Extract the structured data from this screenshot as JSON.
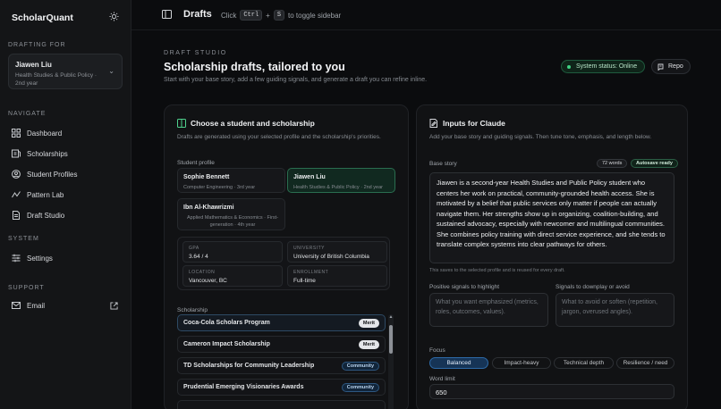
{
  "app": {
    "brand": "ScholarQuant"
  },
  "sidebar": {
    "drafting_for_label": "DRAFTING FOR",
    "profile": {
      "name": "Jiawen Liu",
      "subtitle": "Health Studies & Public Policy · 2nd year"
    },
    "navigate_label": "NAVIGATE",
    "nav": [
      {
        "label": "Dashboard",
        "icon": "dashboard-icon"
      },
      {
        "label": "Scholarships",
        "icon": "scholarships-icon"
      },
      {
        "label": "Student Profiles",
        "icon": "user-icon"
      },
      {
        "label": "Pattern Lab",
        "icon": "pattern-icon"
      },
      {
        "label": "Draft Studio",
        "icon": "document-icon"
      }
    ],
    "system_label": "SYSTEM",
    "settings_label": "Settings",
    "support_label": "SUPPORT",
    "email_label": "Email"
  },
  "topbar": {
    "title": "Drafts",
    "hint_pre": "Click",
    "key1": "Ctrl",
    "plus": "+",
    "key2": "S",
    "hint_post": "to toggle sidebar"
  },
  "header": {
    "eyebrow": "DRAFT STUDIO",
    "title": "Scholarship drafts, tailored to you",
    "subtitle": "Start with your base story, add a few guiding signals, and generate a draft you can refine inline.",
    "status": "System status: Online",
    "repo": "Repo"
  },
  "left_panel": {
    "title": "Choose a student and scholarship",
    "desc": "Drafts are generated using your selected profile and the scholarship's priorities.",
    "student_label": "Student profile",
    "students": [
      {
        "name": "Sophie Bennett",
        "sub": "Computer Engineering · 3rd year"
      },
      {
        "name": "Jiawen Liu",
        "sub": "Health Studies & Public Policy · 2nd year"
      },
      {
        "name": "Ibn Al-Khawrizmi",
        "sub": "Applied Mathematics & Economics · First-generation · 4th year"
      }
    ],
    "stats": [
      {
        "k": "GPA",
        "v": "3.64 / 4"
      },
      {
        "k": "UNIVERSITY",
        "v": "University of British Columbia"
      },
      {
        "k": "LOCATION",
        "v": "Vancouver, BC"
      },
      {
        "k": "ENROLLMENT",
        "v": "Full-time"
      }
    ],
    "scholarship_label": "Scholarship",
    "scholarships": [
      {
        "name": "Coca-Cola Scholars Program",
        "badge": "Merit"
      },
      {
        "name": "Cameron Impact Scholarship",
        "badge": "Merit"
      },
      {
        "name": "TD Scholarships for Community Leadership",
        "badge": "Community"
      },
      {
        "name": "Prudential Emerging Visionaries Awards",
        "badge": "Community"
      }
    ]
  },
  "right_panel": {
    "title": "Inputs for Claude",
    "desc": "Add your base story and guiding signals. Then tune tone, emphasis, and length below.",
    "base_story_label": "Base story",
    "word_count": "72 words",
    "autosave": "Autosave ready",
    "base_story": "Jiawen is a second-year Health Studies and Public Policy student who centers her work on practical, community-grounded health access. She is motivated by a belief that public services only matter if people can actually navigate them. Her strengths show up in organizing, coalition-building, and sustained advocacy, especially with newcomer and multilingual communities. She combines policy training with direct service experience, and she tends to translate complex systems into clear pathways for others.",
    "story_hint": "This saves to the selected profile and is reused for every draft.",
    "positive_label": "Positive signals to highlight",
    "positive_placeholder": "What you want emphasized (metrics, roles, outcomes, values).",
    "negative_label": "Signals to downplay or avoid",
    "negative_placeholder": "What to avoid or soften (repetition, jargon, overused angles).",
    "focus_label": "Focus",
    "focus_options": [
      "Balanced",
      "Impact-heavy",
      "Technical depth",
      "Resilience / need"
    ],
    "focus_selected": "Balanced",
    "word_limit_label": "Word limit",
    "word_limit": "650"
  }
}
